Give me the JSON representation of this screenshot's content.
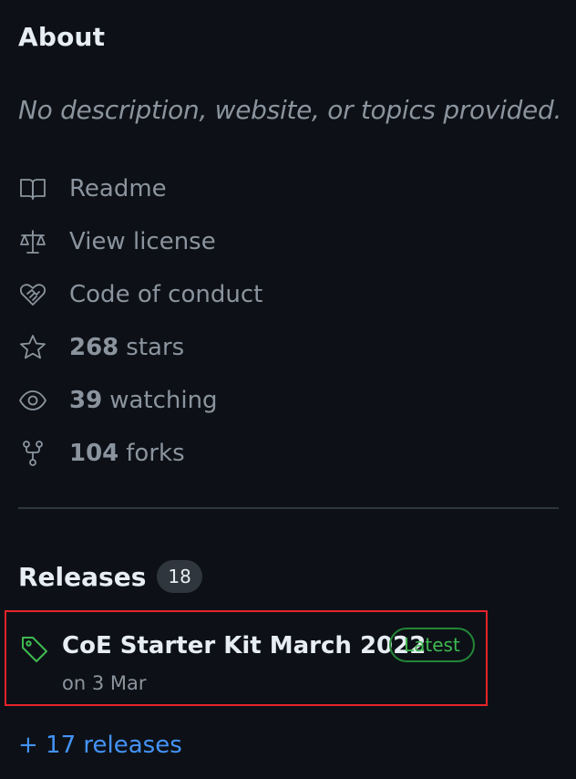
{
  "about": {
    "title": "About",
    "description": "No description, website, or topics provided."
  },
  "meta": {
    "readme": {
      "label": "Readme",
      "icon": "book-icon"
    },
    "license": {
      "label": "View license",
      "icon": "scale-icon"
    },
    "conduct": {
      "label": "Code of conduct",
      "icon": "heart-handshake-icon"
    },
    "stars": {
      "count": "268",
      "label": "stars",
      "icon": "star-icon"
    },
    "watching": {
      "count": "39",
      "label": "watching",
      "icon": "eye-icon"
    },
    "forks": {
      "count": "104",
      "label": "forks",
      "icon": "fork-icon"
    }
  },
  "releases": {
    "title": "Releases",
    "count": "18",
    "latest": {
      "name": "CoE Starter Kit March 2022",
      "badge": "Latest",
      "date": "on 3 Mar",
      "icon": "tag-icon"
    },
    "more_link": "+ 17 releases"
  },
  "colors": {
    "background": "#0d1117",
    "text_primary": "#e6edf3",
    "text_muted": "#8b949e",
    "accent_green": "#3fb950",
    "link_blue": "#4493f8",
    "highlight_red": "#e5242a"
  }
}
